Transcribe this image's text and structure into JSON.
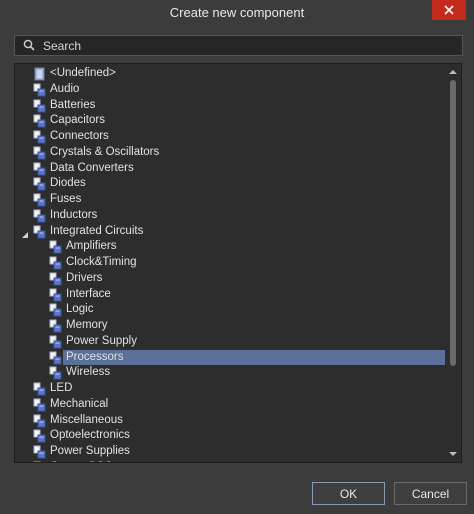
{
  "dialog": {
    "title": "Create new component",
    "close_icon": "close-icon"
  },
  "search": {
    "placeholder": "Search",
    "value": ""
  },
  "tree": {
    "selected": "Processors",
    "items": [
      {
        "label": "<Undefined>",
        "level": 0
      },
      {
        "label": "Audio",
        "level": 0
      },
      {
        "label": "Batteries",
        "level": 0
      },
      {
        "label": "Capacitors",
        "level": 0
      },
      {
        "label": "Connectors",
        "level": 0
      },
      {
        "label": "Crystals & Oscillators",
        "level": 0
      },
      {
        "label": "Data Converters",
        "level": 0
      },
      {
        "label": "Diodes",
        "level": 0
      },
      {
        "label": "Fuses",
        "level": 0
      },
      {
        "label": "Inductors",
        "level": 0
      },
      {
        "label": "Integrated Circuits",
        "level": 0,
        "expanded": true
      },
      {
        "label": "Amplifiers",
        "level": 1
      },
      {
        "label": "Clock&Timing",
        "level": 1
      },
      {
        "label": "Drivers",
        "level": 1
      },
      {
        "label": "Interface",
        "level": 1
      },
      {
        "label": "Logic",
        "level": 1
      },
      {
        "label": "Memory",
        "level": 1
      },
      {
        "label": "Power Supply",
        "level": 1
      },
      {
        "label": "Processors",
        "level": 1,
        "selected": true
      },
      {
        "label": "Wireless",
        "level": 1
      },
      {
        "label": "LED",
        "level": 0
      },
      {
        "label": "Mechanical",
        "level": 0
      },
      {
        "label": "Miscellaneous",
        "level": 0
      },
      {
        "label": "Optoelectronics",
        "level": 0
      },
      {
        "label": "Power Supplies",
        "level": 0
      },
      {
        "label": "Quartz OSC",
        "level": 0
      }
    ]
  },
  "buttons": {
    "ok_label": "OK",
    "cancel_label": "Cancel"
  },
  "colors": {
    "selection": "#5a7099",
    "close": "#c42b1c",
    "background": "#3c3c3c"
  }
}
